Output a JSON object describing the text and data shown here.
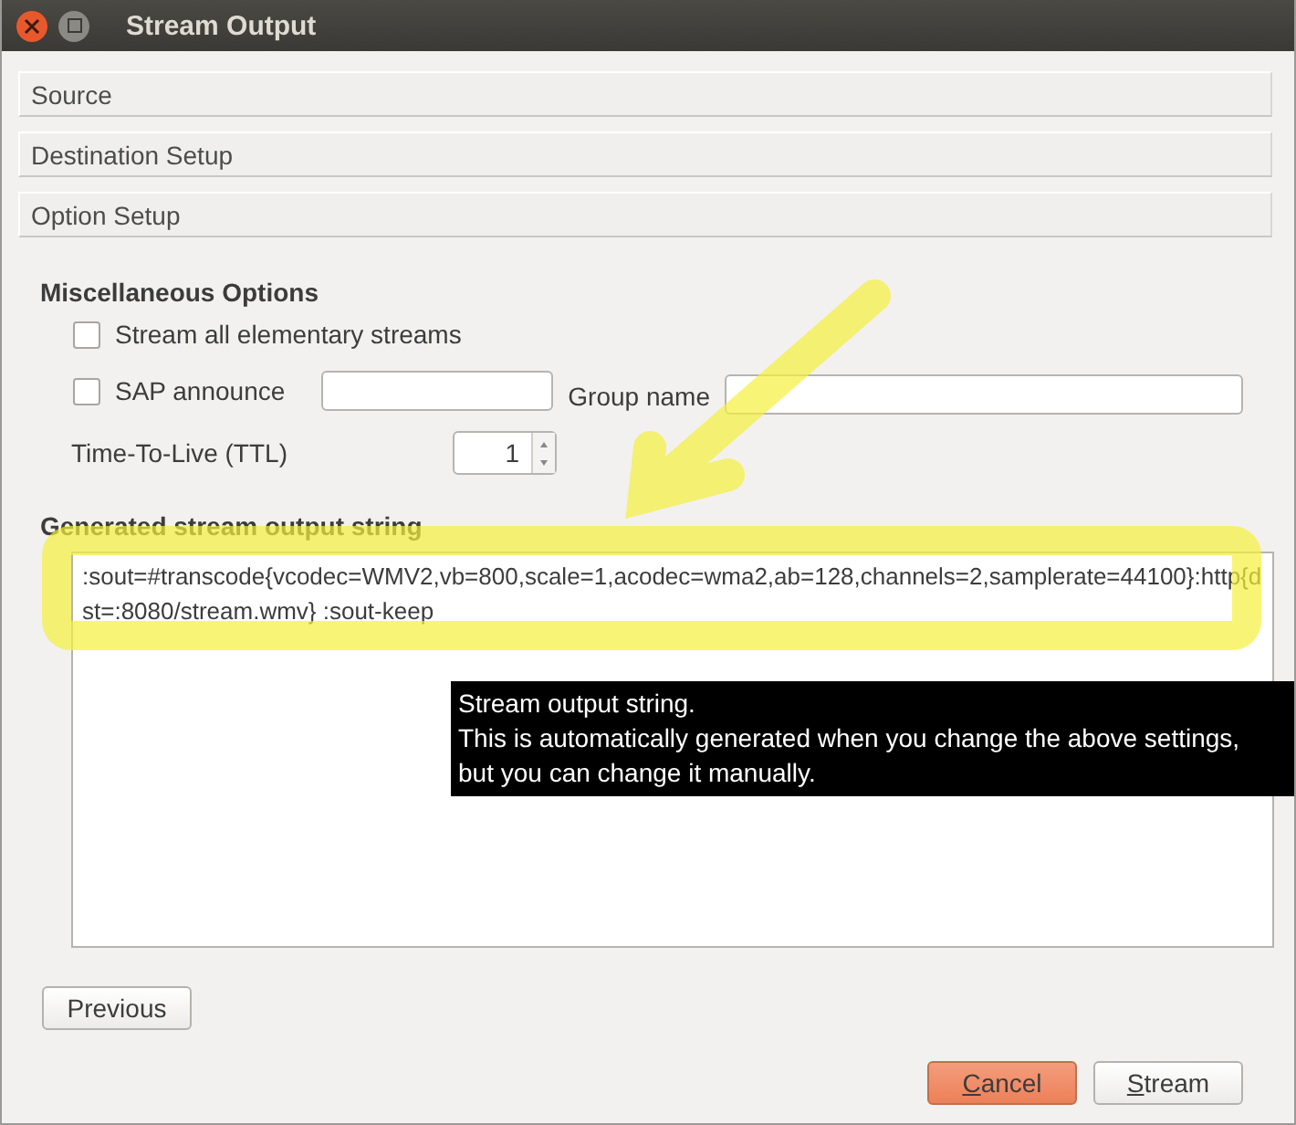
{
  "window": {
    "title": "Stream Output"
  },
  "sections": [
    {
      "label": "Source"
    },
    {
      "label": "Destination Setup"
    },
    {
      "label": "Option Setup"
    }
  ],
  "misc": {
    "heading": "Miscellaneous Options",
    "stream_all": {
      "label": "Stream all elementary streams",
      "checked": false
    },
    "sap": {
      "label": "SAP announce",
      "checked": false
    },
    "group_label": "Group name",
    "ttl_label": "Time-To-Live (TTL)",
    "ttl_value": "1"
  },
  "output": {
    "heading": "Generated stream output string",
    "value": ":sout=#transcode{vcodec=WMV2,vb=800,scale=1,acodec=wma2,ab=128,channels=2,samplerate=44100}:http{dst=:8080/stream.wmv} :sout-keep"
  },
  "tooltip": {
    "lines": [
      "Stream output string.",
      "This is automatically generated when you change the above settings,",
      "but you can change it manually."
    ]
  },
  "annotation": {
    "arrow": true,
    "highlight": true
  },
  "buttons": [
    {
      "label": "Previous",
      "kind": "plain",
      "underline_first": false
    },
    {
      "label": "Cancel",
      "kind": "default",
      "underline_first": true
    },
    {
      "label": "Stream",
      "kind": "plain",
      "underline_first": true
    }
  ]
}
